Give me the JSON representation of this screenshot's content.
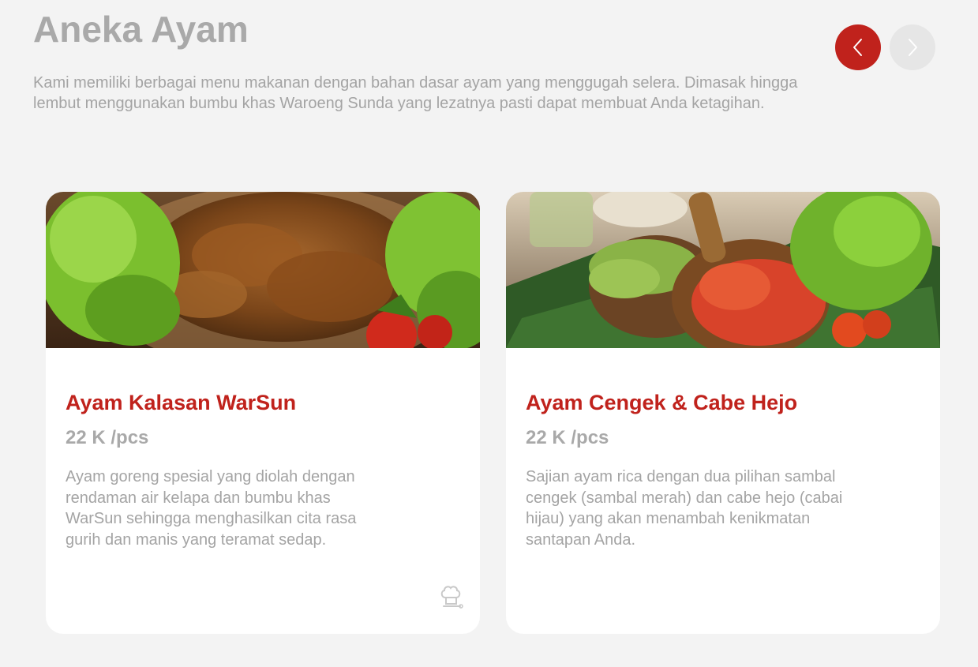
{
  "section": {
    "title": "Aneka Ayam",
    "description": "Kami memiliki berbagai menu makanan dengan bahan dasar ayam yang menggugah selera. Dimasak hingga lembut menggunakan bumbu khas Waroeng Sunda yang lezatnya pasti dapat membuat Anda ketagihan."
  },
  "nav": {
    "prev_icon": "chevron-left-icon",
    "next_icon": "chevron-right-icon",
    "prev_color": "#c0221c",
    "next_color": "#e6e6e6"
  },
  "cards": [
    {
      "name": "Ayam Kalasan WarSun",
      "price": "22 K /pcs",
      "description": "Ayam goreng spesial yang diolah dengan rendaman air kelapa dan bumbu khas WarSun sehingga menghasilkan cita rasa gurih dan manis yang teramat sedap.",
      "badge_icon": "chef-hat-icon"
    },
    {
      "name": "Ayam Cengek & Cabe Hejo",
      "price": "22 K /pcs",
      "description": "Sajian ayam rica dengan dua pilihan sambal cengek (sambal merah) dan cabe hejo (cabai hijau) yang akan menambah kenikmatan santapan Anda."
    }
  ],
  "colors": {
    "accent": "#c0221c",
    "muted_text": "#a9a9a9",
    "background": "#f3f3f3"
  }
}
